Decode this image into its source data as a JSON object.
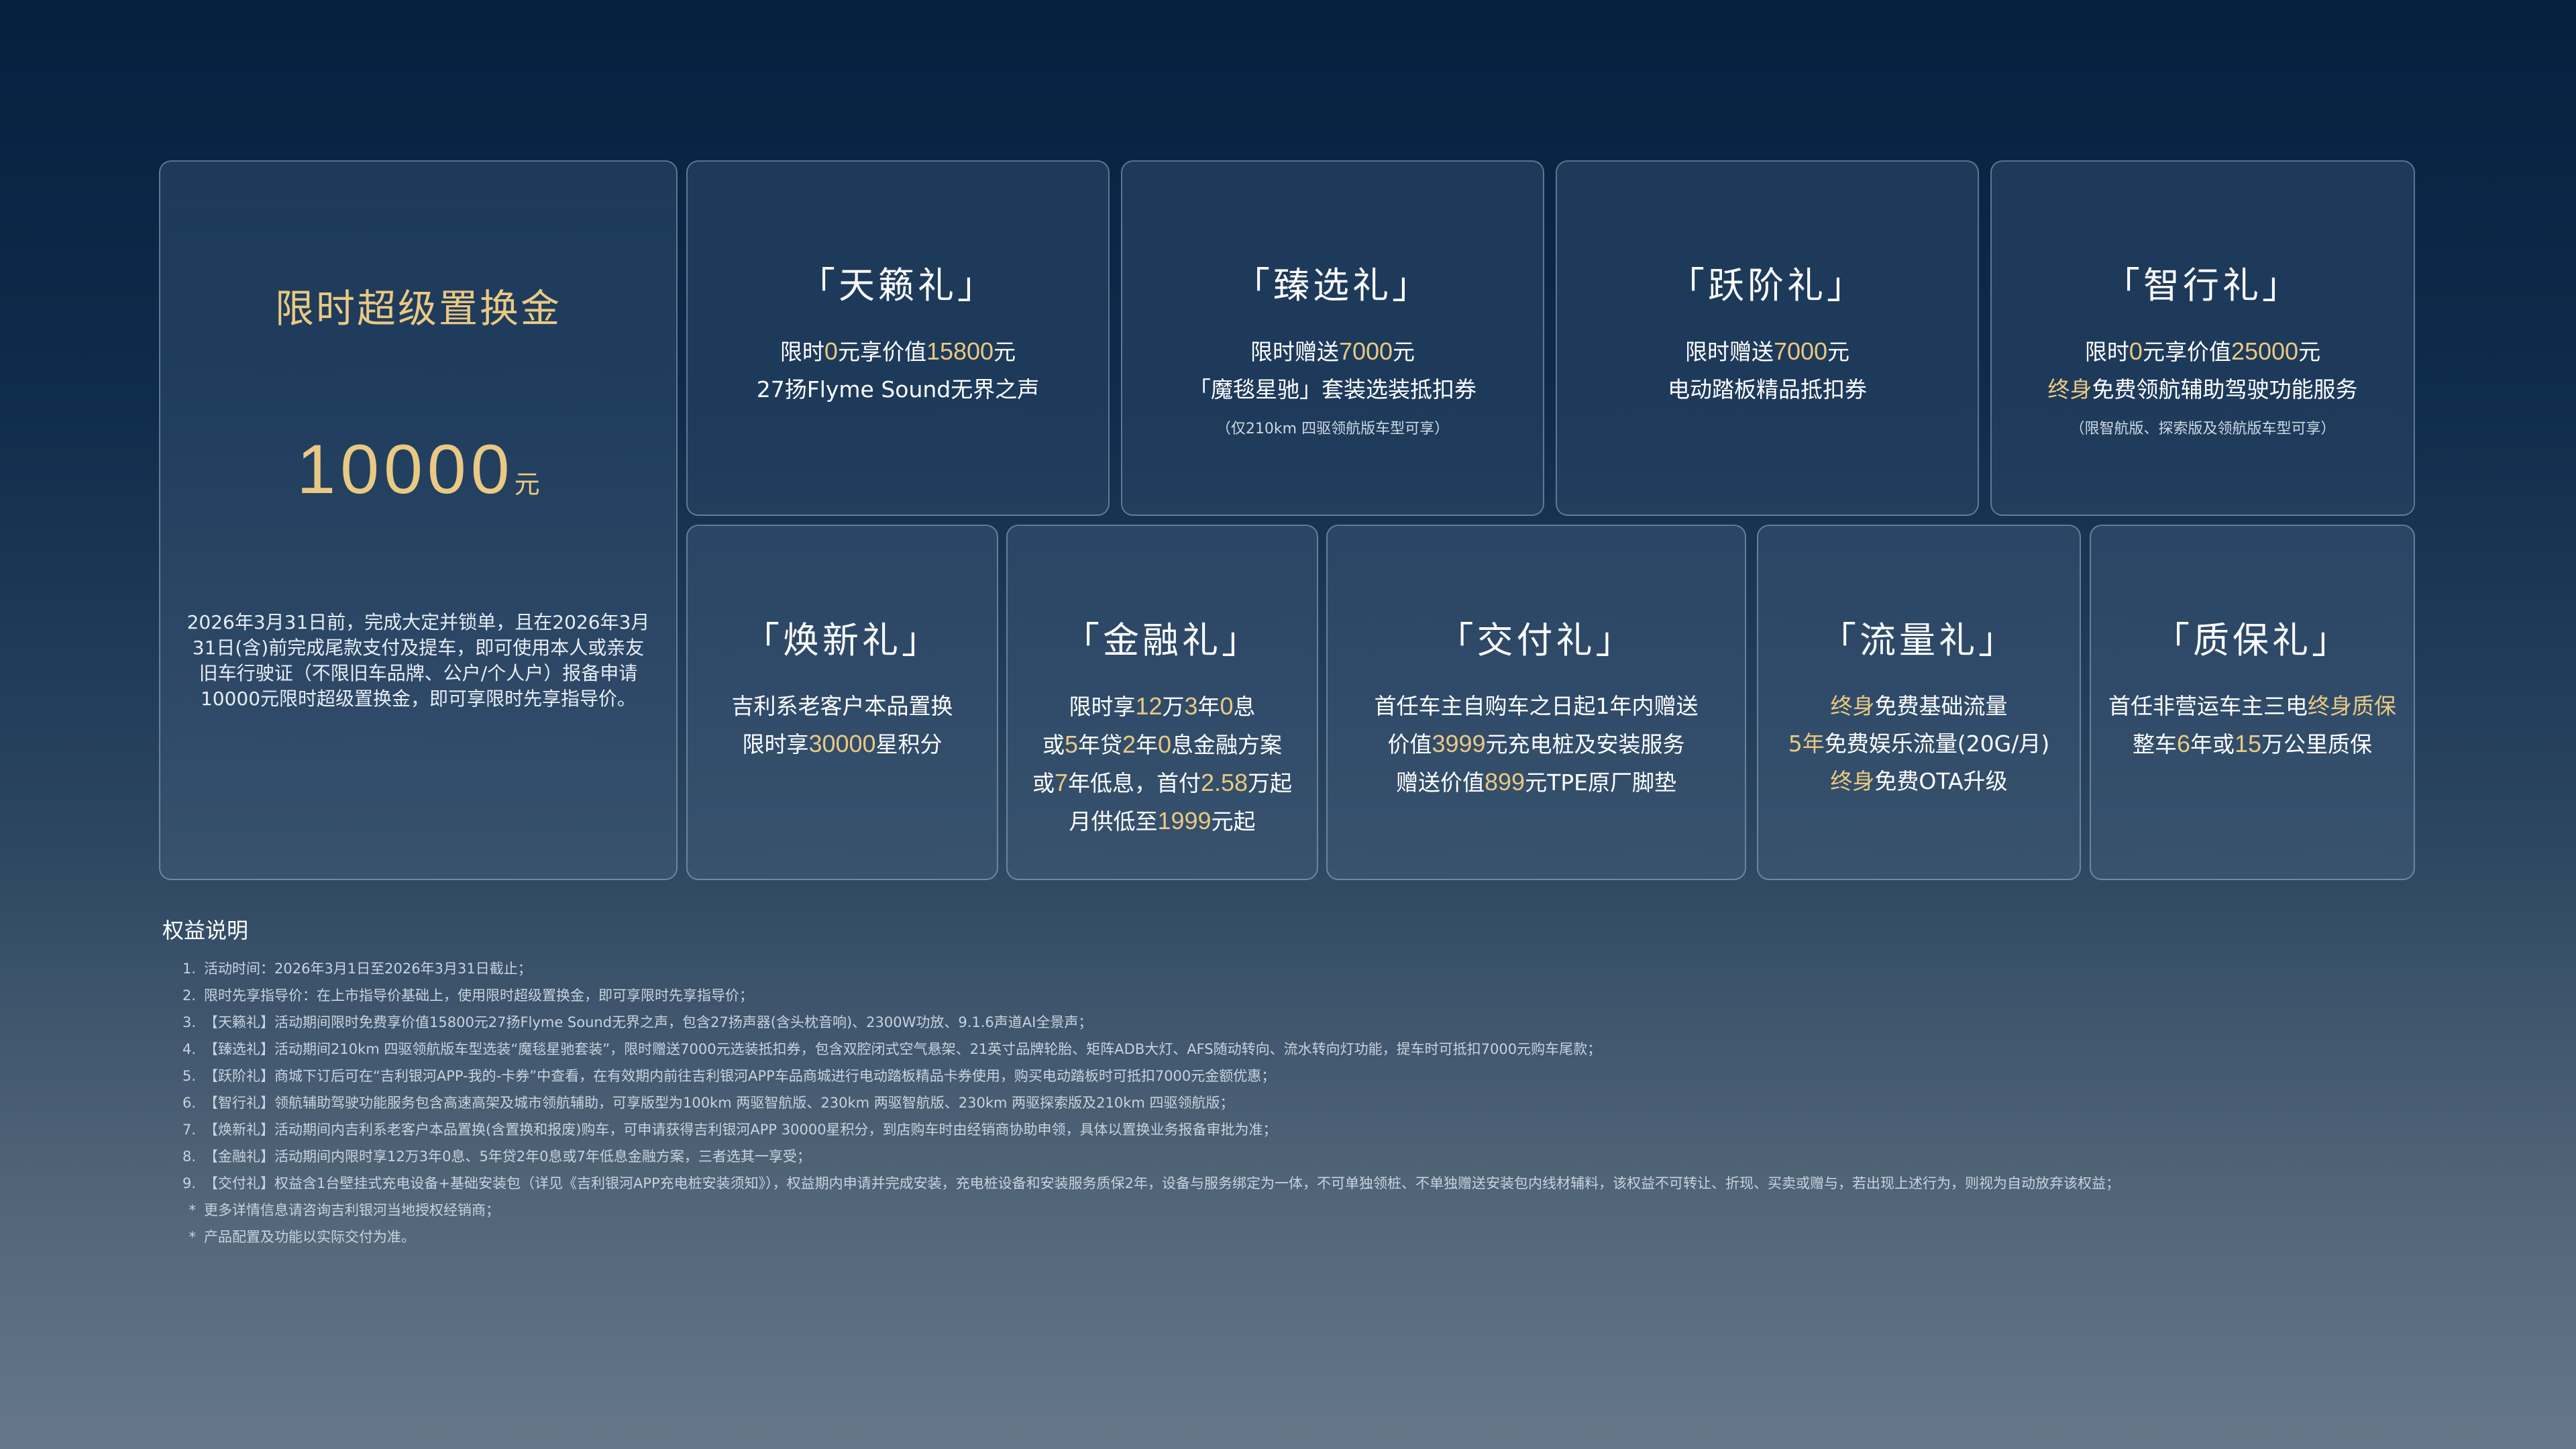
{
  "hero": {
    "title": "限时超级置换金",
    "amount": "10000",
    "unit": "元",
    "description": "2026年3月31日前，完成大定并锁单，且在2026年3月31日(含)前完成尾款支付及提车，即可使用本人或亲友旧车行驶证（不限旧车品牌、公户/个人户）报备申请10000元限时超级置换金，即可享限时先享指导价。"
  },
  "gifts": {
    "tianlai": {
      "title": "「天籁礼」",
      "line1_a": "限时",
      "line1_b": "0",
      "line1_c": "元享价值",
      "line1_d": "15800",
      "line1_e": "元",
      "line2": "27扬Flyme Sound无界之声"
    },
    "zhenxuan": {
      "title": "「臻选礼」",
      "line1_a": "限时赠送",
      "line1_b": "7000",
      "line1_c": "元",
      "line2": "「魔毯星驰」套装选装抵扣券",
      "note": "（仅210km 四驱领航版车型可享）"
    },
    "yuejie": {
      "title": "「跃阶礼」",
      "line1_a": "限时赠送",
      "line1_b": "7000",
      "line1_c": "元",
      "line2": "电动踏板精品抵扣券"
    },
    "zhixing": {
      "title": "「智行礼」",
      "line1_a": "限时",
      "line1_b": "0",
      "line1_c": "元享价值",
      "line1_d": "25000",
      "line1_e": "元",
      "line2_a": "终身",
      "line2_b": "免费领航辅助驾驶功能服务",
      "note": "（限智航版、探索版及领航版车型可享）"
    },
    "huanxin": {
      "title": "「焕新礼」",
      "line1": "吉利系老客户本品置换",
      "line2_a": "限时享",
      "line2_b": "30000",
      "line2_c": "星积分"
    },
    "jinrong": {
      "title": "「金融礼」",
      "l1_a": "限时享",
      "l1_b": "12",
      "l1_c": "万",
      "l1_d": "3",
      "l1_e": "年",
      "l1_f": "0",
      "l1_g": "息",
      "l2_a": "或",
      "l2_b": "5",
      "l2_c": "年贷",
      "l2_d": "2",
      "l2_e": "年",
      "l2_f": "0",
      "l2_g": "息金融方案",
      "l3_a": "或",
      "l3_b": "7",
      "l3_c": "年低息，首付",
      "l3_d": "2.58",
      "l3_e": "万起",
      "l4_a": "月供低至",
      "l4_b": "1999",
      "l4_c": "元起"
    },
    "jiaofu": {
      "title": "「交付礼」",
      "line1": "首任车主自购车之日起1年内赠送",
      "line2_a": "价值",
      "line2_b": "3999",
      "line2_c": "元充电桩及安装服务",
      "line3_a": "赠送价值",
      "line3_b": "899",
      "line3_c": "元TPE原厂脚垫"
    },
    "liuliang": {
      "title": "「流量礼」",
      "line1_a": "终身",
      "line1_b": "免费基础流量",
      "line2_a": "5年",
      "line2_b": "免费娱乐流量(20G/月)",
      "line3_a": "终身",
      "line3_b": "免费OTA升级"
    },
    "zhibao": {
      "title": "「质保礼」",
      "line1_a": "首任非营运车主三电",
      "line1_b": "终身质保",
      "line2_a": "整车",
      "line2_b": "6",
      "line2_c": "年或",
      "line2_d": "15",
      "line2_e": "万公里质保"
    }
  },
  "notes": {
    "title": "权益说明",
    "items": [
      {
        "idx": "1.",
        "text": "活动时间：2026年3月1日至2026年3月31日截止；"
      },
      {
        "idx": "2.",
        "text": "限时先享指导价：在上市指导价基础上，使用限时超级置换金，即可享限时先享指导价；"
      },
      {
        "idx": "3.",
        "text": "【天籁礼】活动期间限时免费享价值15800元27扬Flyme Sound无界之声，包含27扬声器(含头枕音响)、2300W功放、9.1.6声道AI全景声；"
      },
      {
        "idx": "4.",
        "text": "【臻选礼】活动期间210km 四驱领航版车型选装“魔毯星驰套装”，限时赠送7000元选装抵扣券，包含双腔闭式空气悬架、21英寸品牌轮胎、矩阵ADB大灯、AFS随动转向、流水转向灯功能，提车时可抵扣7000元购车尾款；"
      },
      {
        "idx": "5.",
        "text": "【跃阶礼】商城下订后可在“吉利银河APP-我的-卡券”中查看，在有效期内前往吉利银河APP车品商城进行电动踏板精品卡券使用，购买电动踏板时可抵扣7000元金额优惠；"
      },
      {
        "idx": "6.",
        "text": "【智行礼】领航辅助驾驶功能服务包含高速高架及城市领航辅助，可享版型为100km 两驱智航版、230km 两驱智航版、230km 两驱探索版及210km 四驱领航版；"
      },
      {
        "idx": "7.",
        "text": "【焕新礼】活动期间内吉利系老客户本品置换(含置换和报废)购车，可申请获得吉利银河APP 30000星积分，到店购车时由经销商协助申领，具体以置换业务报备审批为准；"
      },
      {
        "idx": "8.",
        "text": "【金融礼】活动期间内限时享12万3年0息、5年贷2年0息或7年低息金融方案，三者选其一享受；"
      },
      {
        "idx": "9.",
        "text": "【交付礼】权益含1台壁挂式充电设备+基础安装包（详见《吉利银河APP充电桩安装须知》），权益期内申请并完成安装，充电桩设备和安装服务质保2年，设备与服务绑定为一体，不可单独领桩、不单独赠送安装包内线材辅料，该权益不可转让、折现、买卖或赠与，若出现上述行为，则视为自动放弃该权益；"
      },
      {
        "idx": "*",
        "text": "更多详情信息请咨询吉利银河当地授权经销商；"
      },
      {
        "idx": "*",
        "text": "产品配置及功能以实际交付为准。"
      }
    ]
  },
  "colors": {
    "accent": "#e9c983",
    "background_top": "#05203f",
    "background_bottom": "#66778a"
  }
}
